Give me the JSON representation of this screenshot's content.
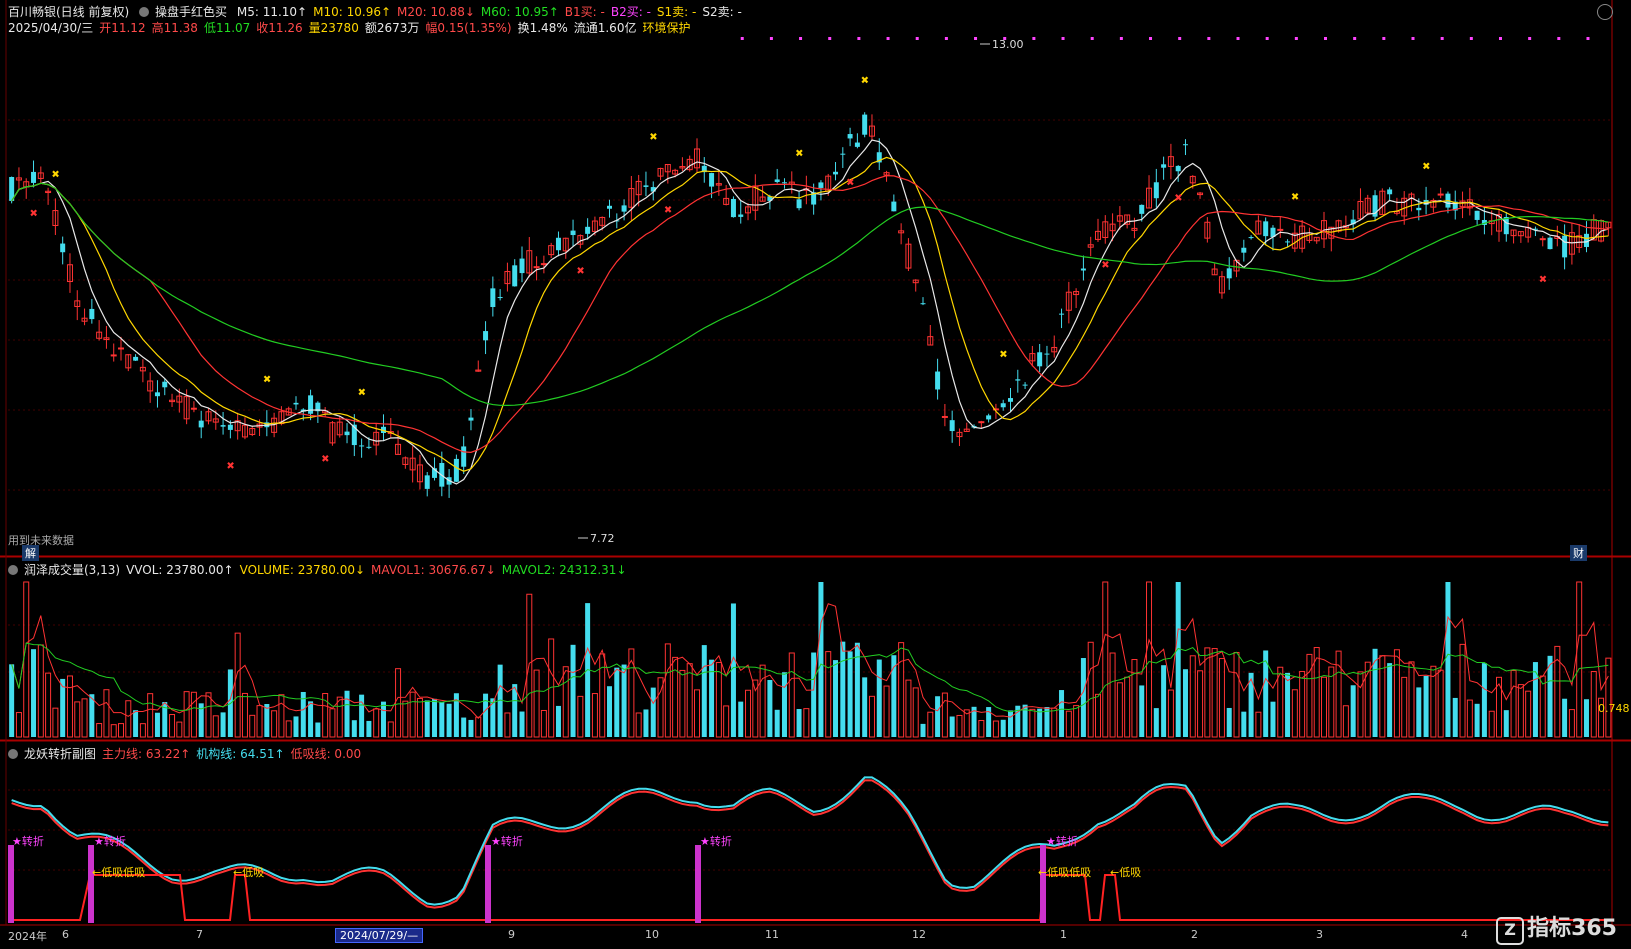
{
  "header": {
    "title": "百川畅银(日线 前复权)",
    "indicator_name": "操盘手红色买",
    "ma_labels": [
      {
        "text": "M5: 11.10↑",
        "color": "#e8e8e8"
      },
      {
        "text": "M10: 10.96↑",
        "color": "#ffd700"
      },
      {
        "text": "M20: 10.88↓",
        "color": "#ff4a4a"
      },
      {
        "text": "M60: 10.95↑",
        "color": "#22dd22"
      },
      {
        "text": "B1买: -",
        "color": "#ff4a4a"
      },
      {
        "text": "B2买: -",
        "color": "#ff44ff"
      },
      {
        "text": "S1卖: -",
        "color": "#ffd700"
      },
      {
        "text": "S2卖: -",
        "color": "#e8e8e8"
      }
    ],
    "quote_line": [
      {
        "text": "2025/04/30/三",
        "color": "#e8e8e8"
      },
      {
        "text": "开11.12",
        "color": "#ff4a4a"
      },
      {
        "text": "高11.38",
        "color": "#ff4a4a"
      },
      {
        "text": "低11.07",
        "color": "#22dd22"
      },
      {
        "text": "收11.26",
        "color": "#ff4a4a"
      },
      {
        "text": "量23780",
        "color": "#ffd700"
      },
      {
        "text": "额2673万",
        "color": "#e8e8e8"
      },
      {
        "text": "幅0.15(1.35%)",
        "color": "#ff4a4a"
      },
      {
        "text": "换1.48%",
        "color": "#e8e8e8"
      },
      {
        "text": "流通1.60亿",
        "color": "#e8e8e8"
      },
      {
        "text": "环境保护",
        "color": "#ffd700"
      }
    ]
  },
  "main_chart": {
    "high_label": "13.00",
    "low_label": "7.72",
    "future_data_note": "用到未来数据",
    "jie_badge": "解",
    "cai_badge": "财"
  },
  "volume_panel": {
    "labels": [
      {
        "text": "润泽成交量(3,13)",
        "color": "#e8e8e8"
      },
      {
        "text": "VVOL: 23780.00↑",
        "color": "#e8e8e8"
      },
      {
        "text": "VOLUME: 23780.00↓",
        "color": "#ffd700"
      },
      {
        "text": "MAVOL1: 30676.67↓",
        "color": "#ff4a4a"
      },
      {
        "text": "MAVOL2: 24312.31↓",
        "color": "#22dd22"
      }
    ],
    "right_value": "0.748"
  },
  "sub_panel": {
    "labels": [
      {
        "text": "龙妖转折副图",
        "color": "#e8e8e8"
      },
      {
        "text": "主力线: 63.22↑",
        "color": "#ff4a4a"
      },
      {
        "text": "机构线: 64.51↑",
        "color": "#44ddee"
      },
      {
        "text": "低吸线: 0.00",
        "color": "#ff4a4a"
      }
    ],
    "turn_label": "★转折",
    "dip_label": "←低吸",
    "dip_double_label": "←低吸低吸"
  },
  "x_axis": {
    "labels": [
      "2024年",
      "6",
      "7",
      "2024/07/29/—",
      "9",
      "10",
      "11",
      "12",
      "1",
      "2",
      "3",
      "4"
    ]
  },
  "watermark": {
    "z": "Z",
    "text": "指标365"
  },
  "colors": {
    "up": "#ff3333",
    "down": "#44ddee",
    "ma5": "#e8e8e8",
    "ma10": "#ffd700",
    "ma20": "#ff3333",
    "ma60": "#22cc22"
  }
}
